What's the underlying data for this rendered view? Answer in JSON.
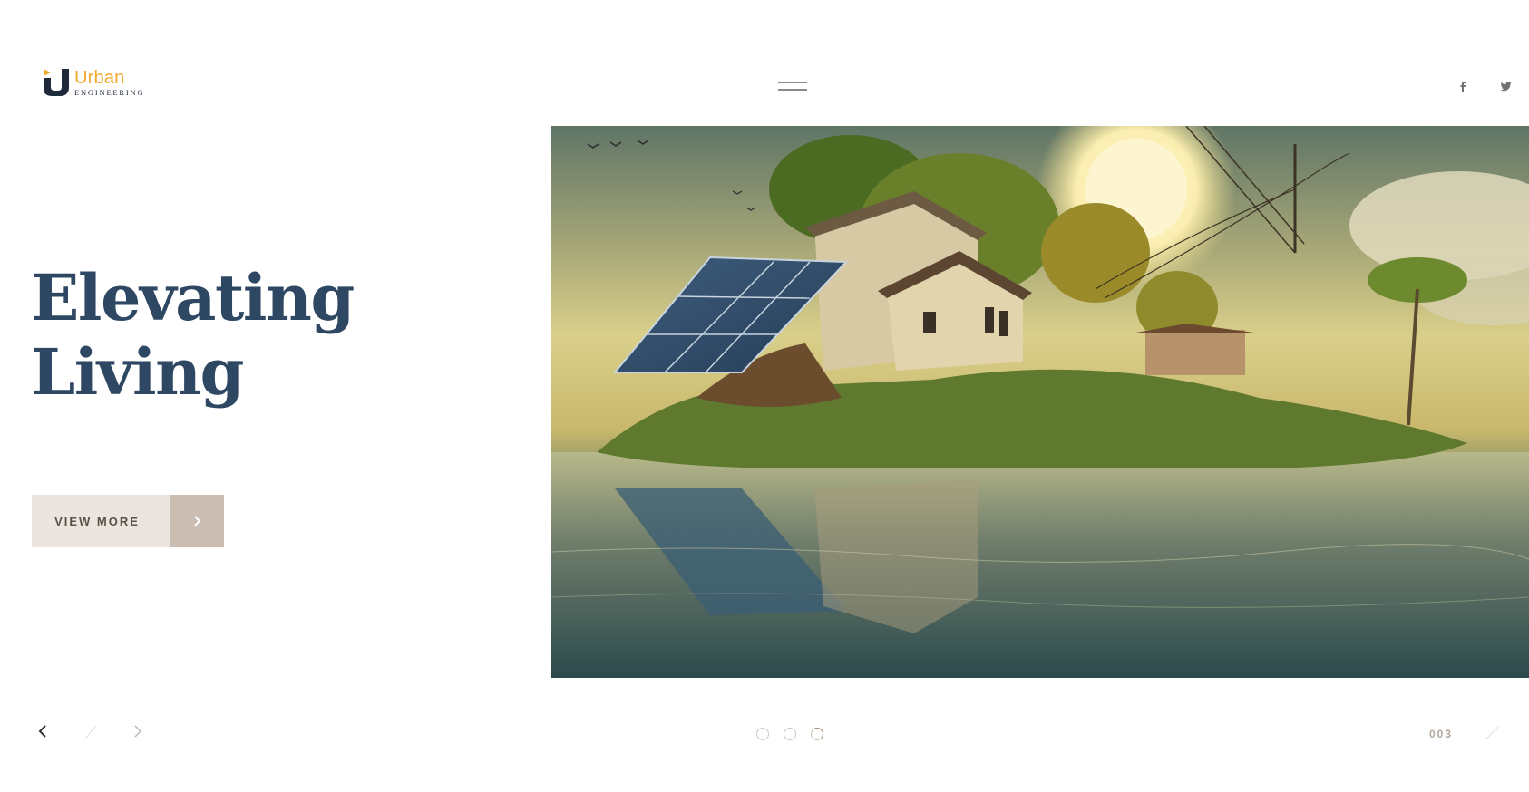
{
  "brand": {
    "name": "Urban",
    "tagline": "ENGINEERING",
    "colors": {
      "accent": "#f0a82d",
      "navy": "#1e2a3a",
      "heading": "#2e4763"
    }
  },
  "header": {
    "menu_icon": "hamburger-icon",
    "social": [
      {
        "name": "facebook",
        "icon": "facebook-icon"
      },
      {
        "name": "twitter",
        "icon": "twitter-icon"
      }
    ]
  },
  "hero": {
    "title_line1": "Elevating",
    "title_line2": "Living",
    "cta_label": "VIEW MORE",
    "cta_icon": "chevron-right-icon",
    "image_alt": "house with solar panels on floating island"
  },
  "slider": {
    "prev_icon": "chevron-left-icon",
    "next_icon": "chevron-right-icon",
    "dots": 3,
    "active_index": 2,
    "counter": "003"
  }
}
